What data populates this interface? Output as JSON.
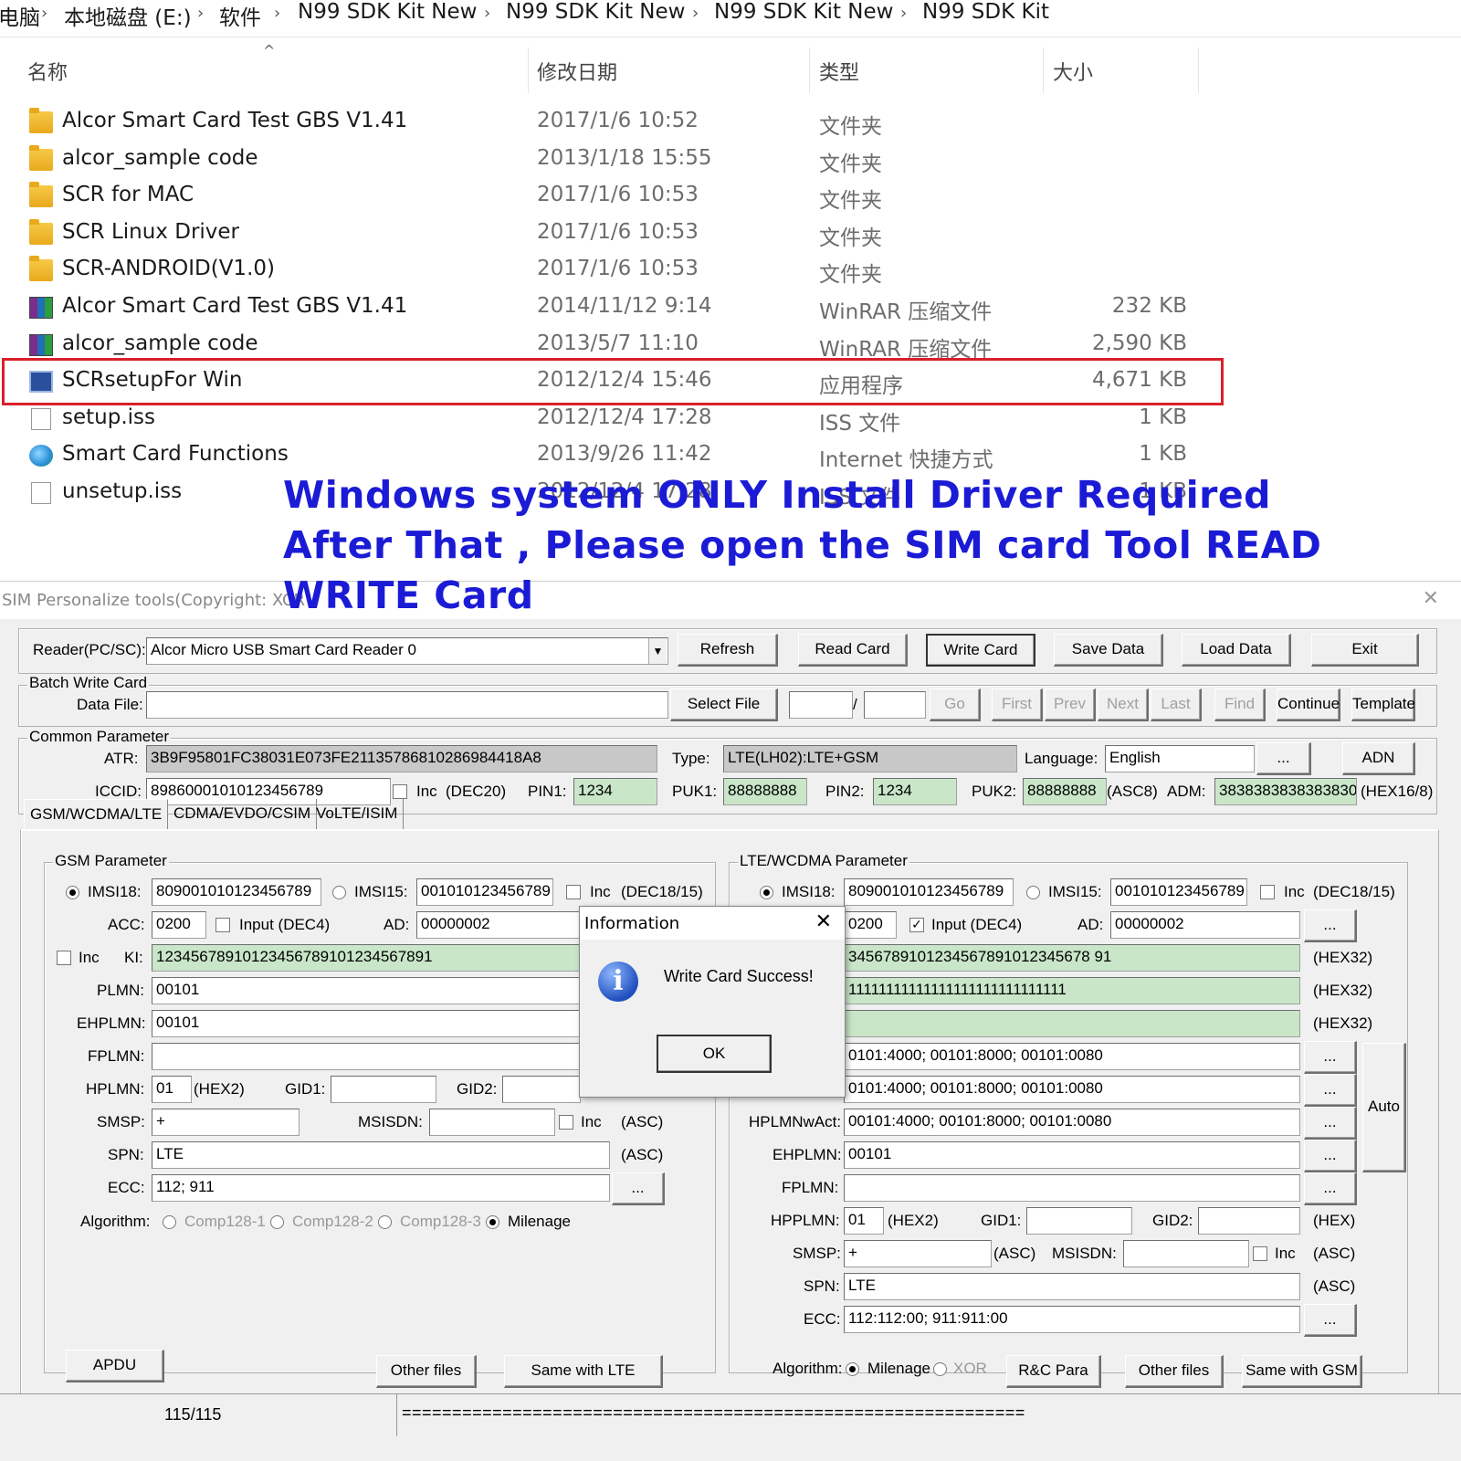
{
  "breadcrumb": [
    "电脑",
    "本地磁盘 (E:)",
    "软件",
    "N99 SDK Kit New",
    "N99 SDK Kit New",
    "N99 SDK Kit New",
    "N99 SDK Kit"
  ],
  "columns": {
    "name": "名称",
    "date": "修改日期",
    "type": "类型",
    "size": "大小"
  },
  "files": [
    {
      "name": "Alcor Smart Card Test GBS V1.41",
      "date": "2017/1/6 10:52",
      "type": "文件夹",
      "size": "",
      "icon": "folder-icon"
    },
    {
      "name": "alcor_sample code",
      "date": "2013/1/18 15:55",
      "type": "文件夹",
      "size": "",
      "icon": "folder-icon"
    },
    {
      "name": "SCR for MAC",
      "date": "2017/1/6 10:53",
      "type": "文件夹",
      "size": "",
      "icon": "folder-icon"
    },
    {
      "name": "SCR Linux Driver",
      "date": "2017/1/6 10:53",
      "type": "文件夹",
      "size": "",
      "icon": "folder-icon"
    },
    {
      "name": "SCR-ANDROID(V1.0)",
      "date": "2017/1/6 10:53",
      "type": "文件夹",
      "size": "",
      "icon": "folder-icon"
    },
    {
      "name": "Alcor Smart Card Test GBS V1.41",
      "date": "2014/11/12 9:14",
      "type": "WinRAR 压缩文件",
      "size": "232 KB",
      "icon": "winrar-icon"
    },
    {
      "name": "alcor_sample code",
      "date": "2013/5/7 11:10",
      "type": "WinRAR 压缩文件",
      "size": "2,590 KB",
      "icon": "winrar-icon"
    },
    {
      "name": "SCRsetupFor Win",
      "date": "2012/12/4 15:46",
      "type": "应用程序",
      "size": "4,671 KB",
      "icon": "installer-icon"
    },
    {
      "name": "setup.iss",
      "date": "2012/12/4 17:28",
      "type": "ISS 文件",
      "size": "1 KB",
      "icon": "file-icon"
    },
    {
      "name": "Smart Card Functions",
      "date": "2013/9/26 11:42",
      "type": "Internet 快捷方式",
      "size": "1 KB",
      "icon": "internet-shortcut-icon"
    },
    {
      "name": "unsetup.iss",
      "date": "2012/12/4 17:28",
      "type": "ISS 文件",
      "size": "1 KB",
      "icon": "file-icon"
    }
  ],
  "overlay": {
    "line1": "Windows system ONLY  Install Driver Required",
    "line2": "After That , Please open the SIM card Tool READ",
    "line3": "WRITE Card",
    "color": "#1b1bd6"
  },
  "highlight_color": "#d9202a",
  "tool": {
    "title": "SIM Personalize tools(Copyright: XCR",
    "reader_label": "Reader(PC/SC):",
    "reader_value": "Alcor Micro USB Smart Card Reader 0",
    "buttons": {
      "refresh": "Refresh",
      "read": "Read Card",
      "write": "Write Card",
      "save": "Save Data",
      "load": "Load Data",
      "exit": "Exit"
    },
    "batch": {
      "title": "Batch Write Card",
      "data_file_label": "Data File:",
      "select_file": "Select File",
      "slash": "/",
      "go": "Go",
      "first": "First",
      "prev": "Prev",
      "next": "Next",
      "last": "Last",
      "find": "Find",
      "continue": "Continue",
      "template": "Template"
    },
    "common": {
      "title": "Common Parameter",
      "atr_label": "ATR:",
      "atr": "3B9F95801FC38031E073FE21135786810286984418A8",
      "type_label": "Type:",
      "type": "LTE(LH02):LTE+GSM",
      "language_label": "Language:",
      "language": "English",
      "more": "...",
      "adn": "ADN",
      "iccid_label": "ICCID:",
      "iccid": "89860001010123456789",
      "inc": "Inc",
      "dec20": "(DEC20)",
      "pin1_label": "PIN1:",
      "pin1": "1234",
      "puk1_label": "PUK1:",
      "puk1": "88888888",
      "pin2_label": "PIN2:",
      "pin2": "1234",
      "puk2_label": "PUK2:",
      "puk2": "88888888",
      "asc8": "(ASC8)",
      "adm_label": "ADM:",
      "adm": "3838383838383830",
      "hex168": "(HEX16/8)"
    },
    "tabs": [
      "GSM/WCDMA/LTE",
      "CDMA/EVDO/CSIM",
      "VoLTE/ISIM"
    ],
    "gsm": {
      "title": "GSM Parameter",
      "imsi18_label": "IMSI18:",
      "imsi18": "809001010123456789",
      "imsi15_label": "IMSI15:",
      "imsi15": "001010123456789",
      "inc": "Inc",
      "dec1815": "(DEC18/15)",
      "acc_label": "ACC:",
      "acc": "0200",
      "input_dec4": "Input (DEC4)",
      "ad_label": "AD:",
      "ad": "00000002",
      "ki_label": "KI:",
      "ki": "12345678910123456789101234567891",
      "plmn_label": "PLMN:",
      "plmn": "00101",
      "ehplmn_label": "EHPLMN:",
      "ehplmn": "00101",
      "fplmn_label": "FPLMN:",
      "fplmn": "",
      "hplmn_label": "HPLMN:",
      "hplmn": "01",
      "hex2": "(HEX2)",
      "gid1_label": "GID1:",
      "gid2_label": "GID2:",
      "smsp_label": "SMSP:",
      "smsp": "+",
      "msisdn_label": "MSISDN:",
      "asc": "(ASC)",
      "spn_label": "SPN:",
      "spn": "LTE",
      "ecc_label": "ECC:",
      "ecc": "112; 911",
      "algorithm_label": "Algorithm:",
      "alg": [
        "Comp128-1",
        "Comp128-2",
        "Comp128-3",
        "Milenage"
      ],
      "apdu": "APDU",
      "other_files": "Other files",
      "same_with_lte": "Same with LTE"
    },
    "lte": {
      "title": "LTE/WCDMA Parameter",
      "imsi18_label": "IMSI18:",
      "imsi18": "809001010123456789",
      "imsi15_label": "IMSI15:",
      "imsi15": "001010123456789",
      "inc": "Inc",
      "dec1815": "(DEC18/15)",
      "acc": "0200",
      "input_dec4": "Input (DEC4)",
      "ad_label": "AD:",
      "ad": "00000002",
      "ki": "3456789101234567891012345678 91",
      "opc": "11111111111111111111111111111",
      "hex32": "(HEX32)",
      "plmnwact": "0101:4000; 00101:8000; 00101:0080",
      "oplmnwact": "0101:4000; 00101:8000; 00101:0080",
      "hplmnwact_label": "HPLMNwAct:",
      "hplmnwact": "00101:4000; 00101:8000; 00101:0080",
      "auto": "Auto",
      "ehplmn_label": "EHPLMN:",
      "ehplmn": "00101",
      "fplmn_label": "FPLMN:",
      "hpplmn_label": "HPPLMN:",
      "hpplmn": "01",
      "hex2": "(HEX2)",
      "gid1_label": "GID1:",
      "gid2_label": "GID2:",
      "hex": "(HEX)",
      "smsp_label": "SMSP:",
      "smsp": "+",
      "asc": "(ASC)",
      "msisdn_label": "MSISDN:",
      "spn_label": "SPN:",
      "spn": "LTE",
      "ecc_label": "ECC:",
      "ecc": "112:112:00; 911:911:00",
      "algorithm_label": "Algorithm:",
      "milenage": "Milenage",
      "xor": "XOR",
      "rc_para": "R&C Para",
      "other_files": "Other files",
      "same_with_gsm": "Same with GSM"
    },
    "dialog": {
      "title": "Information",
      "message": "Write Card Success!",
      "ok": "OK"
    },
    "status": {
      "count": "115/115",
      "progress": "=============================================================="
    }
  }
}
